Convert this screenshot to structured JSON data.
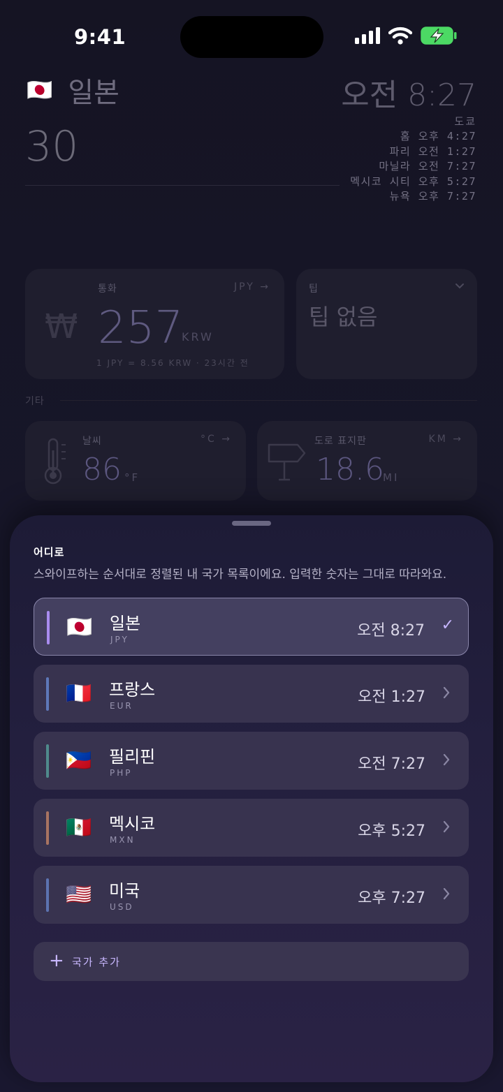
{
  "status_bar": {
    "time": "9:41"
  },
  "header": {
    "flag": "🇯🇵",
    "country": "일본",
    "amount": "30",
    "local_time": "오전 8:27",
    "city": "도쿄",
    "world_clocks": [
      "홈 오후 4:27",
      "파리 오전 1:27",
      "마닐라 오전 7:27",
      "멕시코 시티 오후 5:27",
      "뉴욕 오후 7:27"
    ]
  },
  "currency_card": {
    "label": "통화",
    "unit_toggle": "JPY →",
    "symbol": "₩",
    "value": "257",
    "code": "KRW",
    "rate": "1 JPY = 8.56 KRW · 23시간 전"
  },
  "tip_card": {
    "label": "팁",
    "chevron": "chevron-down-icon",
    "text": "팁 없음"
  },
  "section_other": "기타",
  "weather_card": {
    "label": "날씨",
    "unit_toggle": "°C →",
    "value": "86",
    "unit": "°F"
  },
  "road_card": {
    "label": "도로 표지판",
    "unit_toggle": "KM →",
    "value": "18.6",
    "unit": "MI"
  },
  "sheet": {
    "title": "어디로",
    "description": "스와이프하는 순서대로 정렬된 내 국가 목록이에요. 입력한 숫자는 그대로 따라와요.",
    "countries": [
      {
        "flag": "🇯🇵",
        "name": "일본",
        "code": "JPY",
        "time": "오전 8:27",
        "accent": "#a98cf0",
        "selected": true
      },
      {
        "flag": "🇫🇷",
        "name": "프랑스",
        "code": "EUR",
        "time": "오전 1:27",
        "accent": "#5e78b8",
        "selected": false
      },
      {
        "flag": "🇵🇭",
        "name": "필리핀",
        "code": "PHP",
        "time": "오전 7:27",
        "accent": "#4f8a8c",
        "selected": false
      },
      {
        "flag": "🇲🇽",
        "name": "멕시코",
        "code": "MXN",
        "time": "오후 5:27",
        "accent": "#a87461",
        "selected": false
      },
      {
        "flag": "🇺🇸",
        "name": "미국",
        "code": "USD",
        "time": "오후 7:27",
        "accent": "#5c73b0",
        "selected": false
      }
    ],
    "add_label": "국가 추가"
  }
}
